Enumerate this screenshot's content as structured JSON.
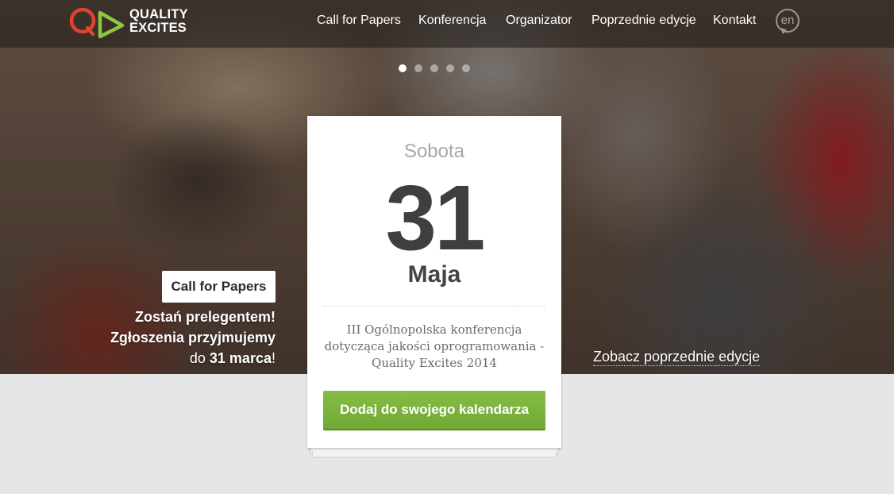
{
  "brand": {
    "logo_line1": "QUALITY",
    "logo_line2": "EXCITES",
    "colors": {
      "red": "#e0432f",
      "green": "#8dc63f"
    }
  },
  "nav": {
    "items": [
      {
        "label": "Call for Papers"
      },
      {
        "label": "Konferencja"
      },
      {
        "label": "Organizator"
      },
      {
        "label": "Poprzednie edycje"
      },
      {
        "label": "Kontakt"
      }
    ],
    "language": "en"
  },
  "slider": {
    "total": 5,
    "active_index": 0
  },
  "cfp": {
    "button_label": "Call for Papers",
    "line1": "Zostań prelegentem!",
    "line2": "Zgłoszenia przyjmujemy",
    "line3_prefix": "do ",
    "line3_bold": "31 marca",
    "line3_suffix": "!"
  },
  "card": {
    "day_name": "Sobota",
    "day_number": "31",
    "month": "Maja",
    "description_line1": "III Ogólnopolska konferencja",
    "description_line2": "dotycząca jakości oprogramowania -",
    "description_line3": "Quality Excites 2014",
    "button_label": "Dodaj do swojego kalendarza"
  },
  "previous_editions_link": "Zobacz poprzednie edycje",
  "colors": {
    "button_green": "#7ab33d",
    "page_bg": "#e6e6e6"
  }
}
